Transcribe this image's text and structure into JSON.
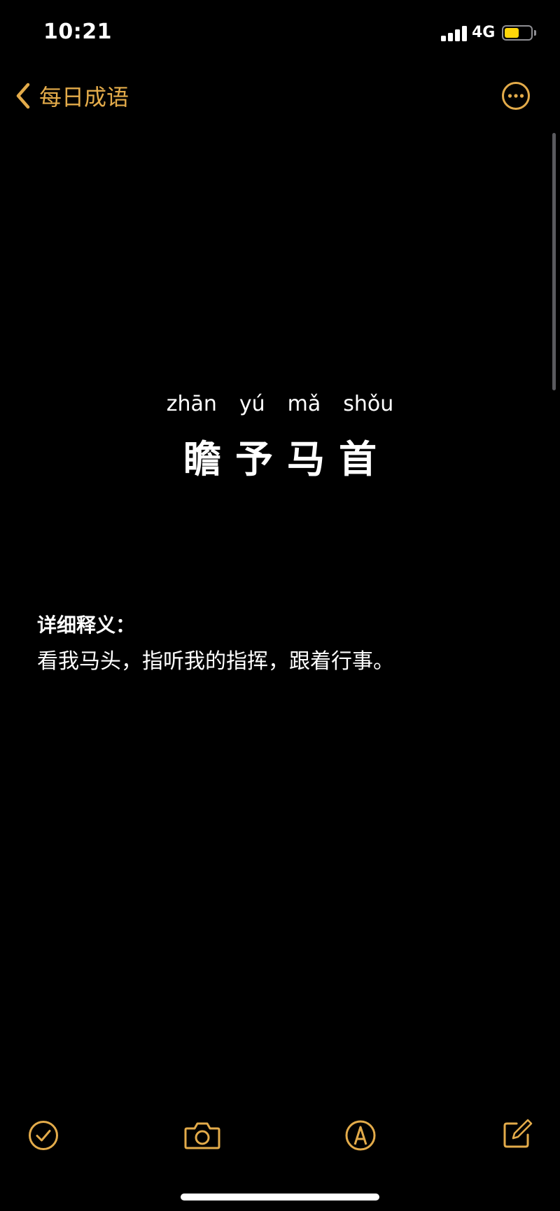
{
  "status_bar": {
    "time": "10:21",
    "network": "4G",
    "battery_level": 0.55,
    "signal_bars": 4
  },
  "nav": {
    "back_label": "每日成语",
    "back_icon": "chevron-left-icon",
    "more_icon": "ellipsis-circle-icon"
  },
  "note": {
    "pinyin": [
      "zhān",
      "yú",
      "mǎ",
      "shǒu"
    ],
    "characters": [
      "瞻",
      "予",
      "马",
      "首"
    ],
    "detail_label": "详细释义：",
    "detail_text": "看我马头，指听我的指挥，跟着行事。"
  },
  "toolbar": {
    "icons": [
      "checklist-icon",
      "camera-icon",
      "markup-pen-icon",
      "compose-icon"
    ]
  },
  "colors": {
    "accent": "#e3ab4a",
    "background": "#000000",
    "text": "#ffffff",
    "battery": "#ffd60a"
  }
}
